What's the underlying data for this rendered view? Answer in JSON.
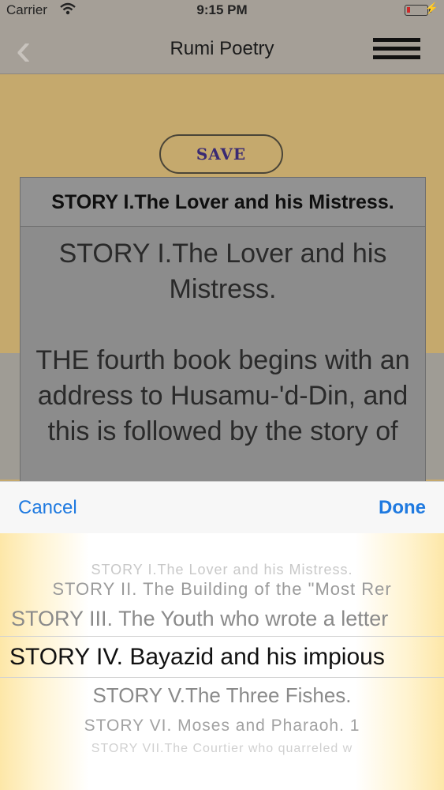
{
  "status": {
    "carrier": "Carrier",
    "wifi_icon": "wifi-icon",
    "time": "9:15 PM",
    "battery_icon": "battery-icon",
    "battery_level_percent": 15,
    "charging_icon": "bolt-icon"
  },
  "nav": {
    "back_icon": "chevron-left-icon",
    "title": "Rumi Poetry",
    "menu_icon": "hamburger-menu-icon"
  },
  "main": {
    "save_label": "SAVE",
    "card_title": "STORY I.The Lover and his Mistress.",
    "body_p1": "STORY I.The Lover and his Mistress.",
    "body_p2": "THE fourth book begins with an address to Husamu-'d-Din, and this is followed by the story of"
  },
  "picker": {
    "cancel_label": "Cancel",
    "done_label": "Done",
    "rows": [
      "STORY I.The Lover and his Mistress.",
      "STORY II. The Building of the \"Most Rer",
      "STORY III. The Youth who wrote a letter",
      "STORY IV. Bayazid and his impious",
      "STORY V.The Three Fishes.",
      "STORY VI. Moses and Pharaoh. 1",
      "STORY VII.The Courtier who quarreled w"
    ],
    "selected_index": 3
  },
  "colors": {
    "accent": "#1f7ae0",
    "save_text": "#3a2a73",
    "page_bg": "#c5a96d"
  }
}
